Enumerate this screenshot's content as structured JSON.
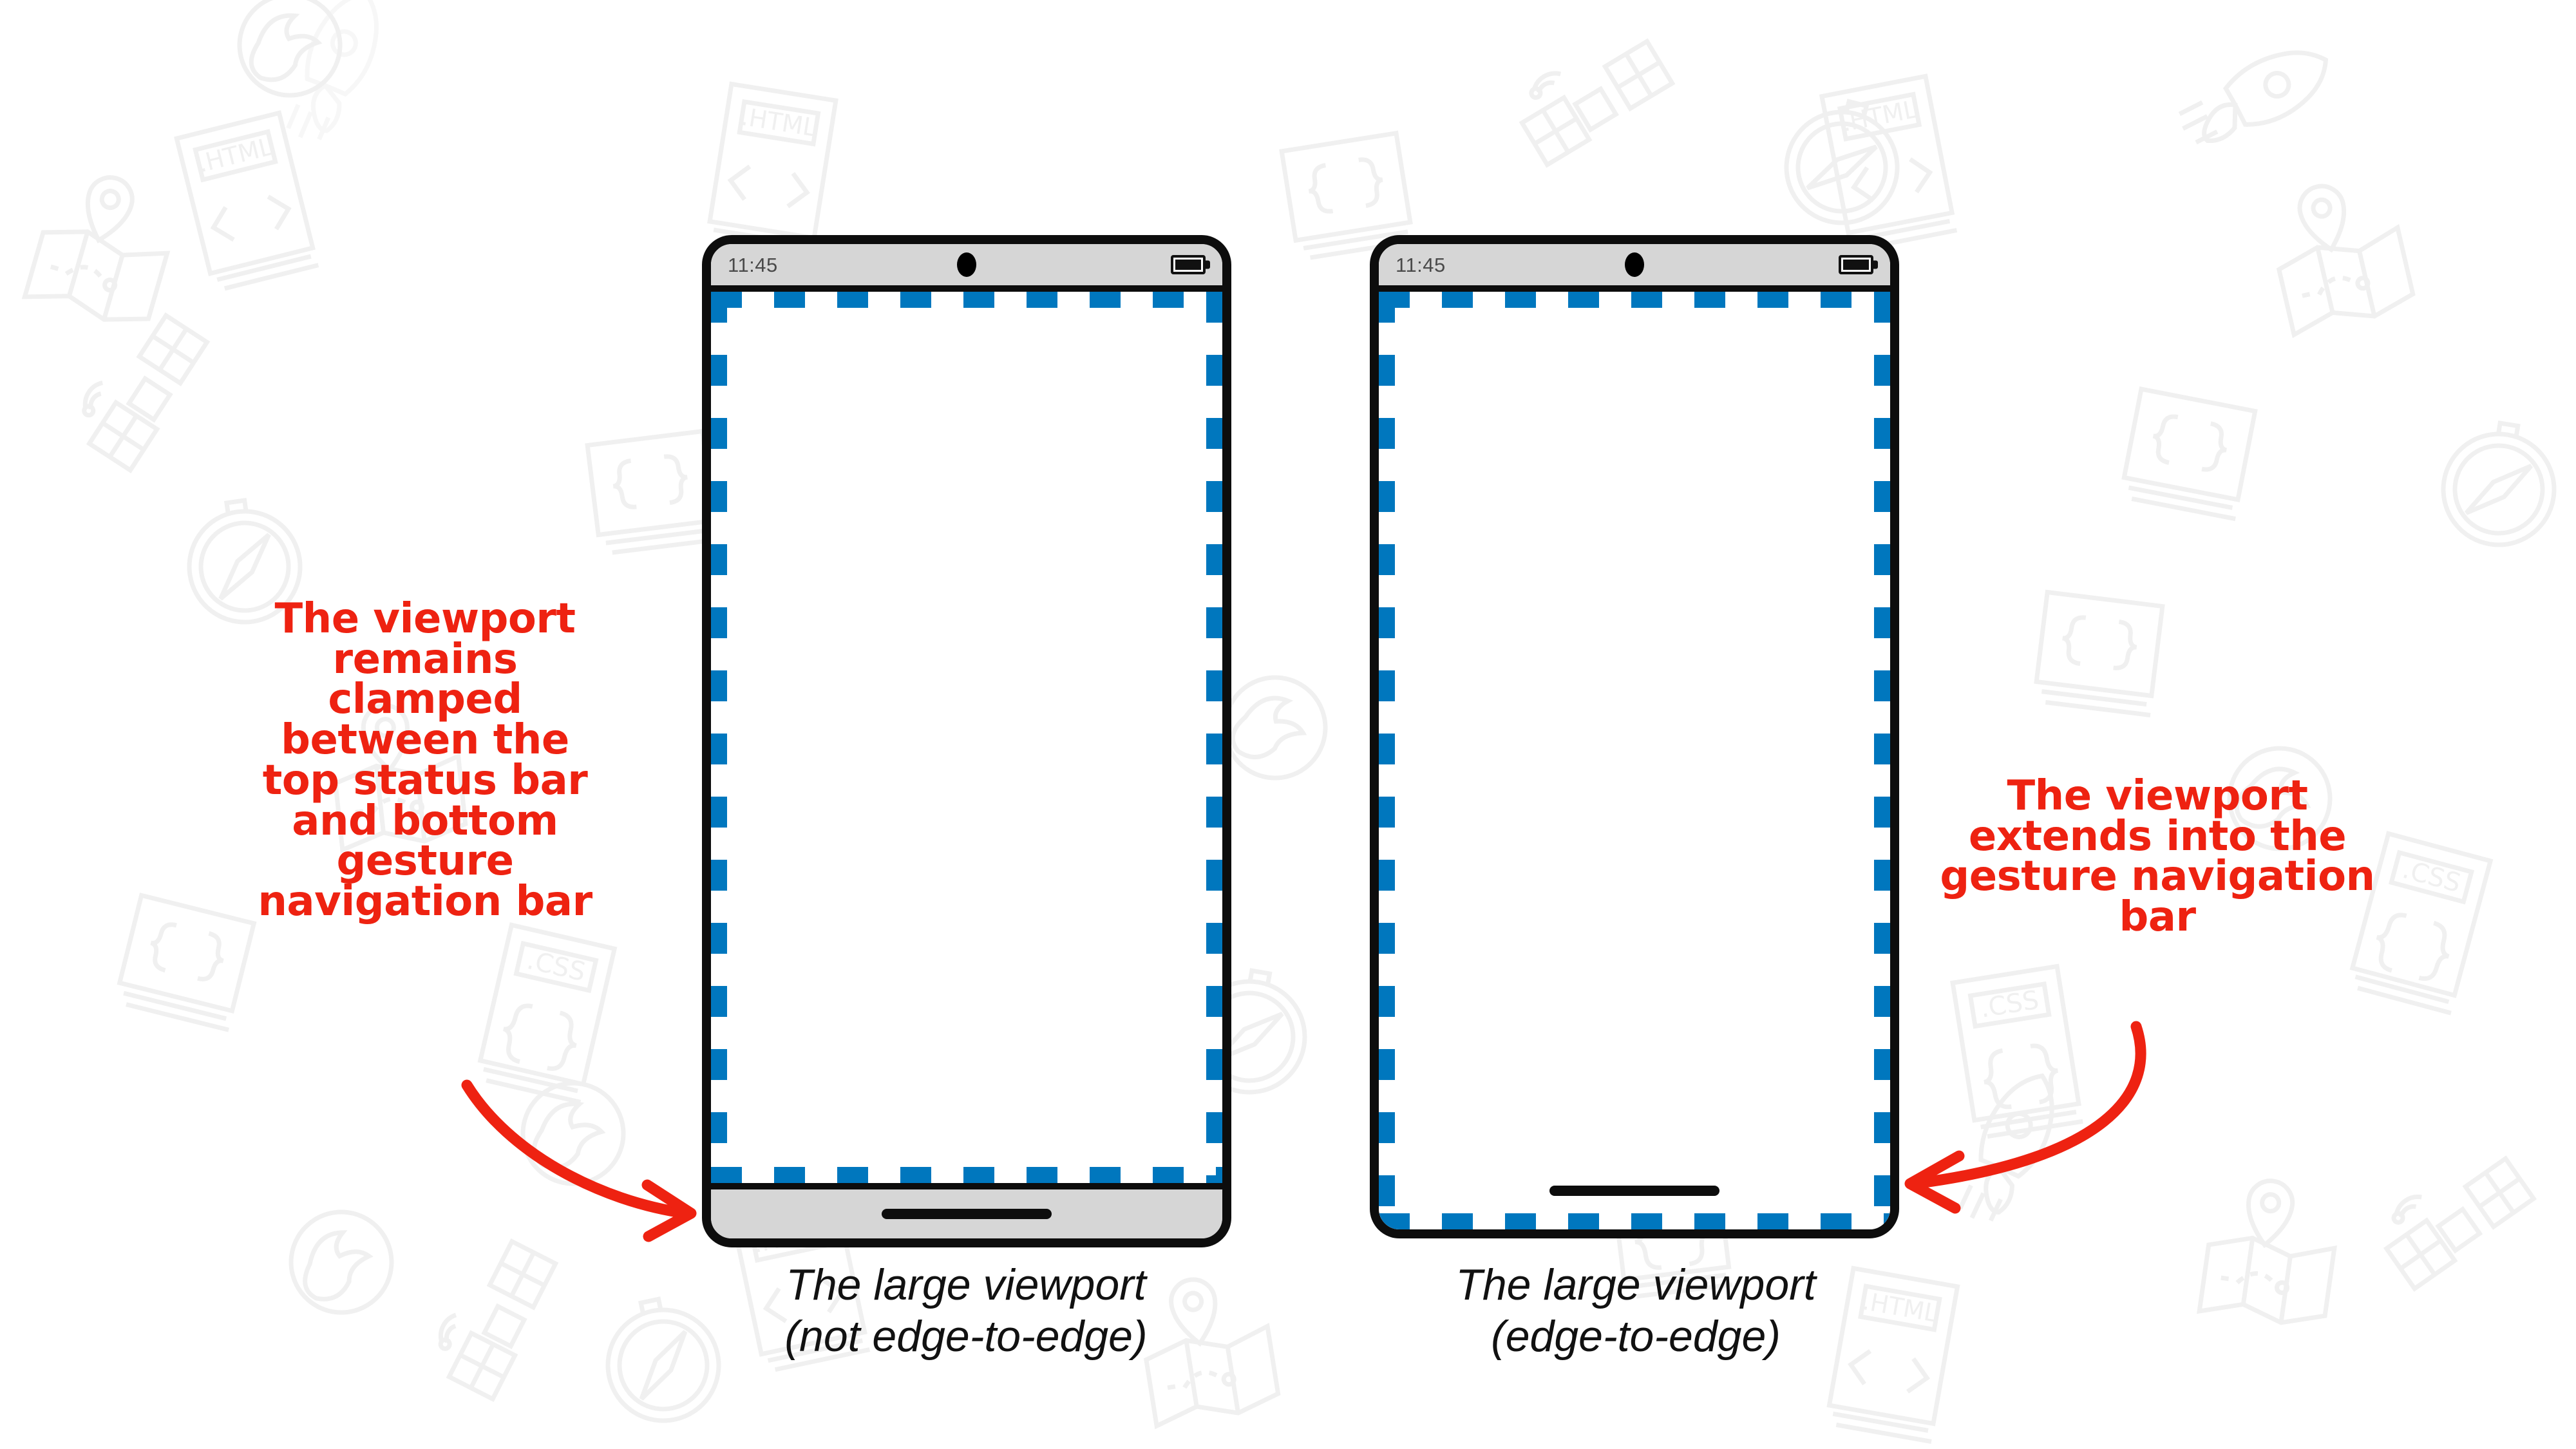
{
  "page": {
    "background_color": "#ffffff",
    "accent_blue": "#0077be",
    "annotation_red": "#ee2211",
    "frame_black": "#0d0d0d",
    "chrome_gray": "#d6d6d6"
  },
  "devices": [
    {
      "id": "not-edge-to-edge",
      "status_bar": {
        "time": "11:45",
        "camera_icon": "camera-punch-hole",
        "battery_icon": "battery-full-icon"
      },
      "viewport": {
        "outline_style": "dashed",
        "outline_color": "#0077be",
        "edge_to_edge": false
      },
      "gesture_bar": {
        "visible": true,
        "style": "opaque-gray",
        "pill_icon": "gesture-handle-pill"
      },
      "caption": "The large viewport\n(not edge-to-edge)"
    },
    {
      "id": "edge-to-edge",
      "status_bar": {
        "time": "11:45",
        "camera_icon": "camera-punch-hole",
        "battery_icon": "battery-full-icon"
      },
      "viewport": {
        "outline_style": "dashed",
        "outline_color": "#0077be",
        "edge_to_edge": true
      },
      "gesture_bar": {
        "visible": true,
        "style": "transparent-overlay",
        "pill_icon": "gesture-handle-pill"
      },
      "caption": "The large viewport\n(edge-to-edge)"
    }
  ],
  "annotations": [
    {
      "id": "left-note",
      "text": "The viewport\nremains\nclamped\nbetween the\ntop status bar\nand bottom\ngesture\nnavigation bar",
      "color": "#ee2211",
      "arrow": "curved-arrow-right"
    },
    {
      "id": "right-note",
      "text": "The viewport\nextends into the\ngesture navigation\nbar",
      "color": "#ee2211",
      "arrow": "curved-arrow-left"
    }
  ],
  "watermark": {
    "icons": [
      "firefox-icon",
      "rocket-icon",
      "satellite-icon",
      "map-pin-icon",
      "html-file-icon",
      "css-file-icon",
      "compass-icon",
      "code-braces-icon"
    ],
    "color": "#f2f2f2"
  }
}
